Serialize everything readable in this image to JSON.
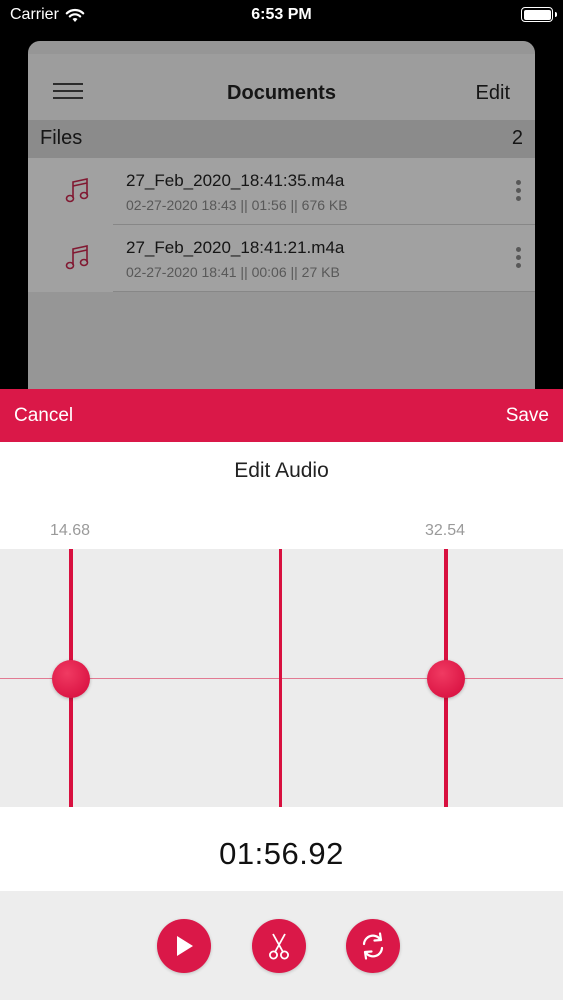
{
  "status_bar": {
    "carrier": "Carrier",
    "time": "6:53 PM"
  },
  "documents": {
    "title": "Documents",
    "edit_label": "Edit",
    "files_label": "Files",
    "files_count": "2",
    "files": [
      {
        "name": "27_Feb_2020_18:41:35.m4a",
        "meta": "02-27-2020 18:43 || 01:56 || 676 KB"
      },
      {
        "name": "27_Feb_2020_18:41:21.m4a",
        "meta": "02-27-2020 18:41 || 00:06 || 27 KB"
      }
    ]
  },
  "editor": {
    "cancel_label": "Cancel",
    "save_label": "Save",
    "title": "Edit Audio",
    "start_marker": "14.68",
    "end_marker": "32.54",
    "current_time": "01:56.92"
  },
  "colors": {
    "accent": "#da1848",
    "waveform_bg": "#ececec"
  },
  "icons": {
    "play": "play-icon",
    "trim": "scissors-icon",
    "reset": "refresh-icon",
    "file": "music-note-icon",
    "menu": "hamburger-icon",
    "more": "more-vertical-icon"
  }
}
